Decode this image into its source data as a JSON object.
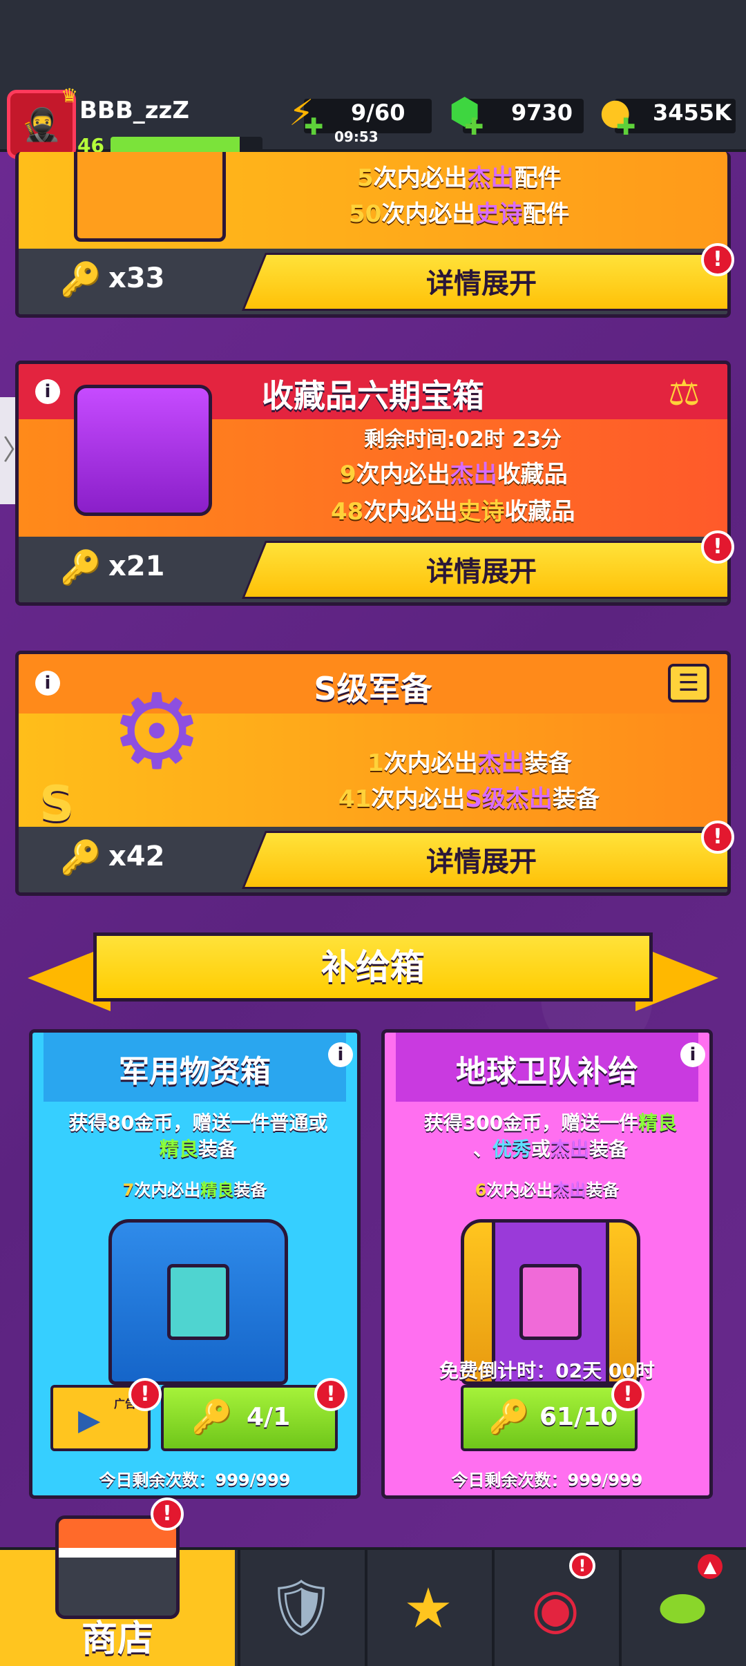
{
  "player": {
    "name": "BBB_zzZ",
    "level": "46",
    "xp_fraction": 0.85
  },
  "resources": {
    "energy": "9/60",
    "energy_timer": "09:53",
    "gems": "9730",
    "coins": "3455K"
  },
  "colors": {
    "background": "#6a2a8e",
    "accent_yellow": "#ffc107",
    "alert_red": "#e3182f",
    "green_button": "#8ad62a"
  },
  "cards": [
    {
      "lines": [
        {
          "pre": "5",
          "mid": "次内必出",
          "hl": "杰出",
          "post": "配件"
        },
        {
          "pre": "50",
          "mid": "次内必出",
          "hl": "史诗",
          "post": "配件"
        }
      ],
      "key_count": "x33",
      "button": "详情展开"
    },
    {
      "title": "收藏品六期宝箱",
      "timer": "剩余时间:02时 23分",
      "lines": [
        {
          "pre": "9",
          "mid": "次内必出",
          "hl": "杰出",
          "post": "收藏品"
        },
        {
          "pre": "48",
          "mid": "次内必出",
          "hl": "史诗",
          "post": "收藏品"
        }
      ],
      "key_count": "x21",
      "button": "详情展开"
    },
    {
      "title": "S级军备",
      "lines": [
        {
          "pre": "1",
          "mid": "次内必出",
          "hl": "杰出",
          "post": "装备"
        },
        {
          "pre": "41",
          "mid": "次内必出",
          "hl": "S级杰出",
          "post": "装备"
        }
      ],
      "key_count": "x42",
      "button": "详情展开"
    }
  ],
  "supply": {
    "title": "补给箱",
    "boxes": [
      {
        "title": "军用物资箱",
        "desc_a": "获得80金币，赠送一件普通或",
        "desc_b_hl": "精良",
        "desc_b_post": "装备",
        "g_pre": "7",
        "g_mid": "次内必出",
        "g_hl": "精良",
        "g_post": "装备",
        "ad_label": "广告",
        "key_btn": "4/1",
        "remaining": "今日剩余次数：999/999"
      },
      {
        "title": "地球卫队补给",
        "desc_a_pre": "获得300金币，赠送一件",
        "desc_a_hl": "精良",
        "desc_b_pre": "、",
        "desc_b_hl": "优秀",
        "desc_b_mid": "或",
        "desc_b_hl2": "杰出",
        "desc_b_post": "装备",
        "g_pre": "6",
        "g_mid": "次内必出",
        "g_hl": "杰出",
        "g_post": "装备",
        "countdown": "免费倒计时：02天 00时",
        "key_btn": "61/10",
        "remaining": "今日剩余次数：999/999"
      }
    ]
  },
  "nav": {
    "shop": "商店"
  },
  "alert_mark": "!"
}
